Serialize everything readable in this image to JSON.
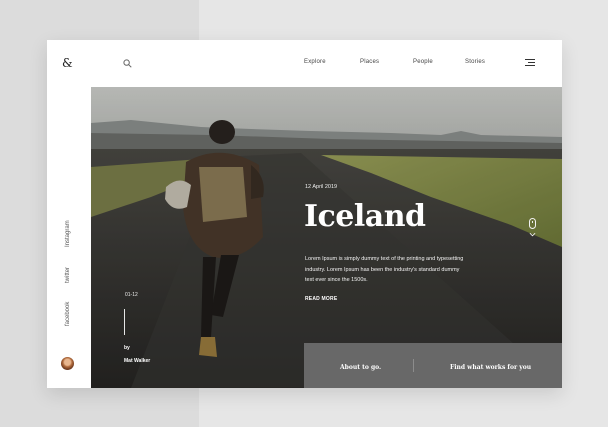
{
  "brand": {
    "logo": "&"
  },
  "nav": {
    "items": [
      {
        "label": "Explore"
      },
      {
        "label": "Places"
      },
      {
        "label": "People"
      },
      {
        "label": "Stories"
      }
    ]
  },
  "icons": {
    "search": "search-icon",
    "menu": "hamburger-menu-icon",
    "scroll": "mouse-scroll-icon",
    "scroll_down": "chevron-down-icon"
  },
  "social": {
    "items": [
      {
        "label": "Instagram"
      },
      {
        "label": "twitter"
      },
      {
        "label": "facebook"
      }
    ]
  },
  "hero": {
    "date": "12 April 2019",
    "title": "Iceland",
    "description": "Lorem Ipsum is simply dummy text of the printing and typesetting industry. Lorem Ipsum has been the industry's standard dummy text ever since the 1500s.",
    "read_more": "READ MORE",
    "counter": "01-12",
    "by": "by",
    "author": "Mat Walker"
  },
  "bottom": {
    "left": "About to go.",
    "right": "Find what works for you"
  },
  "colors": {
    "panel": "#686868",
    "text_light": "#ffffff",
    "accent_dark": "#222222"
  }
}
